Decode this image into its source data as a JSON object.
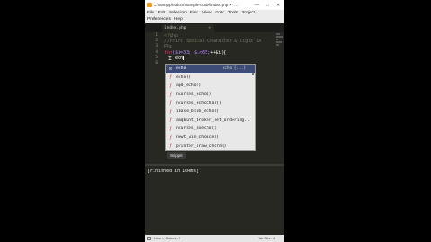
{
  "window": {
    "title": "C:\\xampp\\htdocs\\sample-code\\index.php • - ...",
    "controls": [
      "—",
      "□",
      "✕"
    ]
  },
  "menu": {
    "row1": [
      "File",
      "Edit",
      "Selection",
      "Find",
      "View",
      "Goto",
      "Tools",
      "Project"
    ],
    "row2": [
      "Preferences",
      "Help"
    ]
  },
  "tab": {
    "label": "index.php",
    "close": "×"
  },
  "gutter": [
    "1",
    "2",
    "3",
    "4",
    "5",
    "6"
  ],
  "code": {
    "line1": "<?php",
    "line2": "//Print Spoical Character & Digit In",
    "line3": "Php",
    "line4_for": "for",
    "line4_rest_a": "($i=33; $i<65;",
    "line4_rest_b": "++$i){",
    "line5": "    ech",
    "line6": ""
  },
  "autocomplete": {
    "items": [
      {
        "icon": "⊡",
        "label": "echo",
        "hint": "echo {...}",
        "selected": true
      },
      {
        "icon": "f",
        "label": "echo()"
      },
      {
        "icon": "f",
        "label": "apd_echo()"
      },
      {
        "icon": "f",
        "label": "ncurses_echo()"
      },
      {
        "icon": "f",
        "label": "ncurses_echochar()"
      },
      {
        "icon": "f",
        "label": "ibase_blob_echo()"
      },
      {
        "icon": "f",
        "label": "amqbunt_broker_set_ordering..."
      },
      {
        "icon": "f",
        "label": "ncurses_noecho()"
      },
      {
        "icon": "f",
        "label": "newt_win_choice()"
      },
      {
        "icon": "f",
        "label": "printer_draw_chord()"
      }
    ],
    "footer": "Snippet"
  },
  "output": {
    "text": "[Finished in 104ms]"
  },
  "status": {
    "left": "Line 4, Column 9",
    "right": "Tab Size: 4"
  }
}
